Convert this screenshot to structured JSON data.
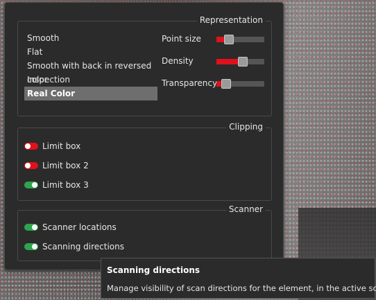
{
  "representation": {
    "title": "Representation",
    "modes": [
      {
        "label": "Smooth",
        "selected": false
      },
      {
        "label": "Flat",
        "selected": false
      },
      {
        "label": "Smooth with back in reversed color",
        "selected": false
      },
      {
        "label": "Inspection",
        "selected": false
      },
      {
        "label": "Real Color",
        "selected": true
      }
    ],
    "sliders": [
      {
        "label": "Point size",
        "value": 0.2
      },
      {
        "label": "Density",
        "value": 0.55
      },
      {
        "label": "Transparency",
        "value": 0.12
      }
    ]
  },
  "clipping": {
    "title": "Clipping",
    "items": [
      {
        "label": "Limit box",
        "enabled": false
      },
      {
        "label": "Limit box 2",
        "enabled": false
      },
      {
        "label": "Limit box 3",
        "enabled": true
      }
    ]
  },
  "scanner": {
    "title": "Scanner",
    "items": [
      {
        "label": "Scanner locations",
        "enabled": true
      },
      {
        "label": "Scanning directions",
        "enabled": true
      }
    ]
  },
  "tooltip": {
    "title": "Scanning directions",
    "text": "Manage visibility of scan directions for the element, in the active scene."
  },
  "colors": {
    "toggle_off": "#e0111b",
    "toggle_on": "#2ea44f",
    "slider_fill": "#e0111b",
    "panel_bg": "#2b2b2b"
  }
}
